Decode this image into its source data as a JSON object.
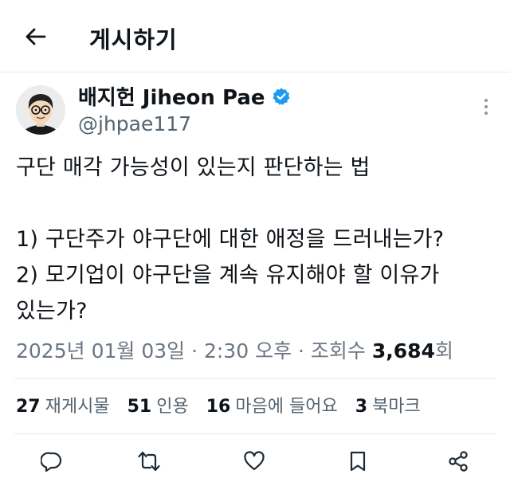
{
  "header": {
    "title": "게시하기"
  },
  "author": {
    "name": "배지헌 Jiheon Pae",
    "handle": "@jhpae117"
  },
  "tweet": {
    "lines": [
      "구단 매각 가능성이 있는지 판단하는 법",
      "1) 구단주가 야구단에 대한 애정을 드러내는가?",
      "2) 모기업이 야구단을 계속 유지해야 할 이유가",
      "있는가?"
    ]
  },
  "meta": {
    "timestamp": "2025년 01월 03일 · 2:30 오후 · 조회수 ",
    "views": "3,684",
    "views_unit": "회"
  },
  "stats": {
    "reposts": {
      "count": "27",
      "label": "재게시물"
    },
    "quotes": {
      "count": "51",
      "label": "인용"
    },
    "likes": {
      "count": "16",
      "label": "마음에 들어요"
    },
    "bookmarks": {
      "count": "3",
      "label": "북마크"
    }
  },
  "colors": {
    "text": "#0f1419",
    "secondary": "#536471",
    "verified": "#1d9bf0",
    "divider": "#e6e9ec"
  }
}
